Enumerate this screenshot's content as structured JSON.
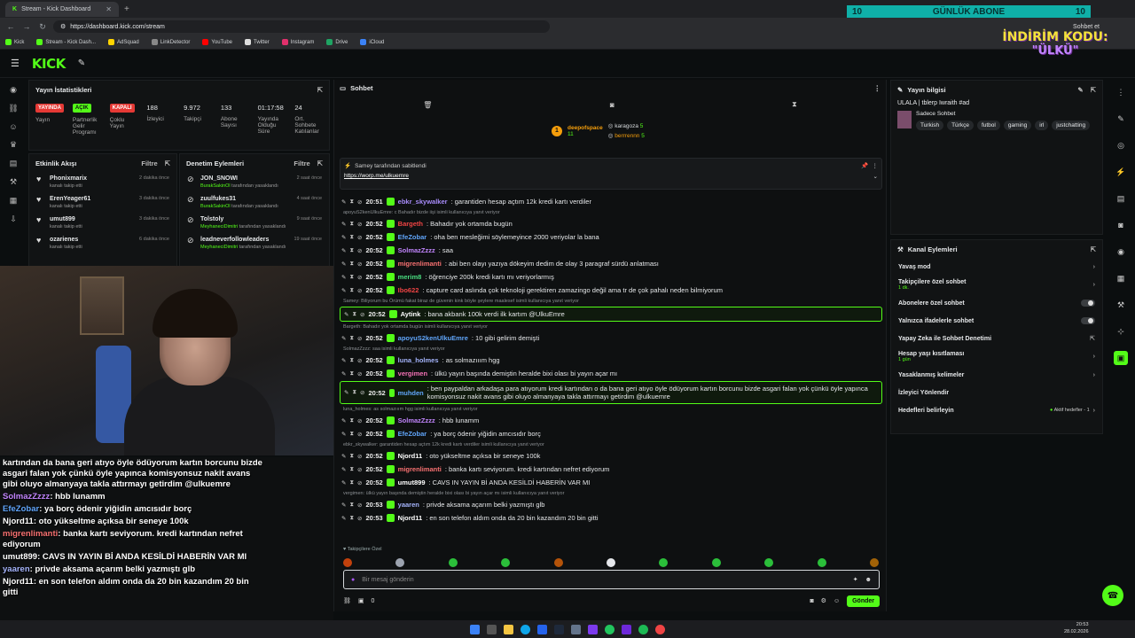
{
  "browser": {
    "tabs": [
      {
        "label": "Stream - Kick Dashboard",
        "color": "#53fc18"
      }
    ],
    "url": "https://dashboard.kick.com/stream",
    "bookmarks": [
      "Kick",
      "Stream - Kick Dash...",
      "AdSquad",
      "LinkDetector",
      "YouTube",
      "Twitter",
      "Instagram",
      "Drive",
      "iCloud"
    ],
    "profile_label": "Sohbet et",
    "side_label": "Ayarlar"
  },
  "overlay": {
    "banner_left": "10",
    "banner_title": "GÜNLÜK ABONE",
    "banner_right": "10",
    "promo_line1": "İNDİRİM KODU:",
    "promo_line2": "\"ÜLKÜ\""
  },
  "header": {
    "logo": "KICK"
  },
  "stats": {
    "title": "Yayın İstatistikleri",
    "items": [
      {
        "badge": "YAYINDA",
        "badge_color": "#e53935",
        "label": "Yayın"
      },
      {
        "badge": "AÇIK",
        "badge_color": "#53fc18",
        "label": "Partnerlik Gelir Programı"
      },
      {
        "badge": "KAPALI",
        "badge_color": "#e53935",
        "label": "Çoklu Yayın"
      },
      {
        "value": "188",
        "label": "İzleyici"
      },
      {
        "value": "9.972",
        "label": "Takipçi"
      },
      {
        "value": "133",
        "label": "Abone Sayısı"
      },
      {
        "value": "01:17:58",
        "label": "Yayında Olduğu Süre"
      },
      {
        "value": "24",
        "label": "Ort. Sohbete Katılanlar"
      }
    ]
  },
  "activity": {
    "title": "Etkinlik Akışı",
    "filter": "Filtre",
    "events": [
      {
        "name": "Phonixmarix",
        "sub": "kanalı takip etti",
        "time": "2 dakika önce"
      },
      {
        "name": "ErenYeager61",
        "sub": "kanalı takip etti",
        "time": "3 dakika önce"
      },
      {
        "name": "umut899",
        "sub": "kanalı takip etti",
        "time": "3 dakika önce"
      },
      {
        "name": "ozarienes",
        "sub": "kanalı takip etti",
        "time": "6 dakika önce"
      }
    ]
  },
  "modlog": {
    "title": "Denetim Eylemleri",
    "filter": "Filtre",
    "events": [
      {
        "name": "JON_SNOWI",
        "actor": "BurakSakinOl",
        "sub": "tarafından yasaklandı",
        "time": "2 saat önce"
      },
      {
        "name": "zuulfukes31",
        "actor": "BurakSakinOl",
        "sub": "tarafından yasaklandı",
        "time": "4 saat önce"
      },
      {
        "name": "Tolstoly",
        "actor": "MeyhaneciDimitri",
        "sub": "tarafından yasaklandı",
        "time": "9 saat önce"
      },
      {
        "name": "leadneverfollowleaders",
        "actor": "MeyhaneciDimitri",
        "sub": "tarafından yasaklandı",
        "time": "19 saat önce"
      }
    ]
  },
  "overlay_chat": [
    {
      "user": "",
      "text": "kartından da bana geri atıyo öyle ödüyorum kartın borcunu bizde asgari falan yok çünkü öyle yapınca komisyonsuz nakit avans gibi oluyo almanyaya takla attırmayı getirdim @ulkuemre",
      "ucolor": "#fff"
    },
    {
      "user": "SolmazZzzz",
      "text": ": hbb lunamm",
      "ucolor": "#c084fc"
    },
    {
      "user": "EfeZobar",
      "text": ": ya borç ödenir yiğidin amcısıdır borç",
      "ucolor": "#60a5fa"
    },
    {
      "user": "Njord11",
      "text": ": oto yükseltme açıksa bir seneye 100k",
      "ucolor": "#fff"
    },
    {
      "user": "migrenlimanti",
      "text": ": banka kartı seviyorum. kredi kartından nefret ediyorum",
      "ucolor": "#f87171"
    },
    {
      "user": "umut899",
      "text": ": CAVS IN YAYIN Bİ ANDA KESİLDİ HABERİN VAR MI",
      "ucolor": "#fff"
    },
    {
      "user": "yaaren",
      "text": ": privde aksama açarım belki yazmıştı glb",
      "ucolor": "#a5b4fc"
    },
    {
      "user": "Njord11",
      "text": ": en son telefon aldım onda da 20 bin kazandım 20 bin gitti",
      "ucolor": "#fff"
    }
  ],
  "chat": {
    "title": "Sohbet",
    "top_gifters": [
      {
        "name": "deepofspace",
        "count": "11"
      },
      {
        "name": "karagoza",
        "count": "5"
      },
      {
        "name": "berrrennn",
        "count": "5"
      }
    ],
    "pinned": {
      "by": "Samey tarafından sabitlendi",
      "link": "https://worp.me/ulkuemre"
    },
    "messages": [
      {
        "reply": "",
        "time": "20:51",
        "user": "ebkr_skywalker",
        "ucolor": "#a78bfa",
        "text": ": garantiden hesap açtım 12k kredi kartı verdiler",
        "hl": false
      },
      {
        "reply": "apoyuS2kenUlkuEmre: c Bahadır bizde iişi isimli kullanıcıya yanıt veriyor",
        "time": "20:52",
        "user": "Bargeth",
        "ucolor": "#ef4444",
        "text": ": Bahadır yok ortamda bugün",
        "hl": false
      },
      {
        "reply": "",
        "time": "20:52",
        "user": "EfeZobar",
        "ucolor": "#60a5fa",
        "text": ": oha ben mesleğimi söylemeyince 2000 veriyolar la bana",
        "hl": false
      },
      {
        "reply": "",
        "time": "20:52",
        "user": "SolmazZzzz",
        "ucolor": "#c084fc",
        "text": ": saa",
        "hl": false
      },
      {
        "reply": "",
        "time": "20:52",
        "user": "migrenlimanti",
        "ucolor": "#f87171",
        "text": ": abi ben olayı yazıya dökeyim dedim de olay 3 paragraf sürdü anlatması",
        "hl": false
      },
      {
        "reply": "",
        "time": "20:52",
        "user": "merim8",
        "ucolor": "#4ade80",
        "text": ": öğrenciye 200k kredi kartı mı veriyorlarmış",
        "hl": false
      },
      {
        "reply": "",
        "time": "20:52",
        "user": "Ibo622",
        "ucolor": "#ef4444",
        "text": ": capture card aslında çok teknoloji gerektiren zamazingo değil ama tr de çok pahalı neden bilmiyorum",
        "hl": false
      },
      {
        "reply": "Samey: Biliyorum bu Örümü fakat biraz de güvenin kink böyle şeylere maalesef isimli kullanıcıya yanıt veriyor",
        "time": "20:52",
        "user": "Aytink",
        "ucolor": "#fff",
        "text": ": bana akbank 100k verdi ilk kartım @UlkuEmre",
        "hl": true
      },
      {
        "reply": "Bargeth: Bahadır yok ortamda bugün isimli kullanıcıya yanıt veriyor",
        "time": "20:52",
        "user": "apoyuS2kenUlkuEmre",
        "ucolor": "#60a5fa",
        "text": ": 10 gibi gelirim demişti",
        "hl": false
      },
      {
        "reply": "SolmazZzzz: saa isimli kullanıcıya yanıt veriyor",
        "time": "20:52",
        "user": "luna_holmes",
        "ucolor": "#a5b4fc",
        "text": ": as solmazııım hgg",
        "hl": false
      },
      {
        "reply": "",
        "time": "20:52",
        "user": "vergimen",
        "ucolor": "#f472b6",
        "text": ": ülkü yayın başında demiştin heralde bixi olası bi yayın açar mı",
        "hl": false
      },
      {
        "reply": "",
        "time": "20:52",
        "user": "muhden",
        "ucolor": "#60a5fa",
        "text": ": ben paypaldan arkadaşa para atıyorum kredi kartından o da bana geri atıyo öyle ödüyorum kartın borcunu bizde asgari falan yok çünkü öyle yapınca komisyonsuz nakit avans gibi oluyo almanyaya takla attırmayı getirdim @ulkuemre",
        "hl": true
      },
      {
        "reply": "luna_holmes: as solmazııım hgg isimli kullanıcıya yanıt veriyor",
        "time": "20:52",
        "user": "SolmazZzzz",
        "ucolor": "#c084fc",
        "text": ": hbb lunamm",
        "hl": false
      },
      {
        "reply": "",
        "time": "20:52",
        "user": "EfeZobar",
        "ucolor": "#60a5fa",
        "text": ": ya borç ödenir yiğidin amcısıdır borç",
        "hl": false
      },
      {
        "reply": "ebkr_skywalker: garantiden hesap açtım 12k kredi kartı verdiler isimli kullanıcıya yanıt veriyor",
        "time": "20:52",
        "user": "Njord11",
        "ucolor": "#fff",
        "text": ": oto yükseltme açıksa bir seneye 100k",
        "hl": false
      },
      {
        "reply": "",
        "time": "20:52",
        "user": "migrenlimanti",
        "ucolor": "#f87171",
        "text": ": banka kartı seviyorum. kredi kartından nefret ediyorum",
        "hl": false
      },
      {
        "reply": "",
        "time": "20:52",
        "user": "umut899",
        "ucolor": "#fff",
        "text": ": CAVS IN YAYIN Bİ ANDA KESİLDİ HABERİN VAR MI",
        "hl": false
      },
      {
        "reply": "vergimen: ülkü yayın başında demiştin heralde bixi olası bi yayın açar mı isimli kullanıcıya yanıt veriyor",
        "time": "20:53",
        "user": "yaaren",
        "ucolor": "#a5b4fc",
        "text": ": privde aksama açarım belki yazmıştı glb",
        "hl": false
      },
      {
        "reply": "",
        "time": "20:53",
        "user": "Njord11",
        "ucolor": "#fff",
        "text": ": en son telefon aldım onda da 20 bin kazandım 20 bin gitti",
        "hl": false
      }
    ],
    "followers_only_label": "Takipçilere Özel",
    "input_placeholder": "Bir mesaj gönderin",
    "points": "0",
    "send": "Gönder"
  },
  "stream_info": {
    "title": "Yayın bilgisi",
    "stream_title": "ULALA | tblerp Iwraith #ad",
    "category": "Sadece Sohbet",
    "tags": [
      "Turkish",
      "Türkçe",
      "futbol",
      "gaming",
      "irl",
      "justchatting"
    ]
  },
  "channel_actions": {
    "title": "Kanal Eylemleri",
    "rows": [
      {
        "label": "Yavaş mod",
        "sub": "",
        "kind": "chevron"
      },
      {
        "label": "Takipçilere özel sohbet",
        "sub": "1 dk.",
        "kind": "chevron"
      },
      {
        "label": "Abonelere özel sohbet",
        "sub": "",
        "kind": "toggle"
      },
      {
        "label": "Yalnızca ifadelerle sohbet",
        "sub": "",
        "kind": "toggle"
      },
      {
        "label": "Yapay Zeka ile Sohbet Denetimi",
        "sub": "",
        "kind": "link"
      },
      {
        "label": "Hesap yaşı kısıtlaması",
        "sub": "1 gün",
        "kind": "chevron"
      },
      {
        "label": "Yasaklanmış kelimeler",
        "sub": "",
        "kind": "chevron"
      },
      {
        "label": "İzleyici Yönlendir",
        "sub": "",
        "kind": "none"
      },
      {
        "label": "Hedefleri belirleyin",
        "sub": "",
        "kind": "goals",
        "status": "Aktif hedefler - 1"
      }
    ]
  },
  "clock": {
    "time": "20:53",
    "date": "28.02.2026"
  }
}
